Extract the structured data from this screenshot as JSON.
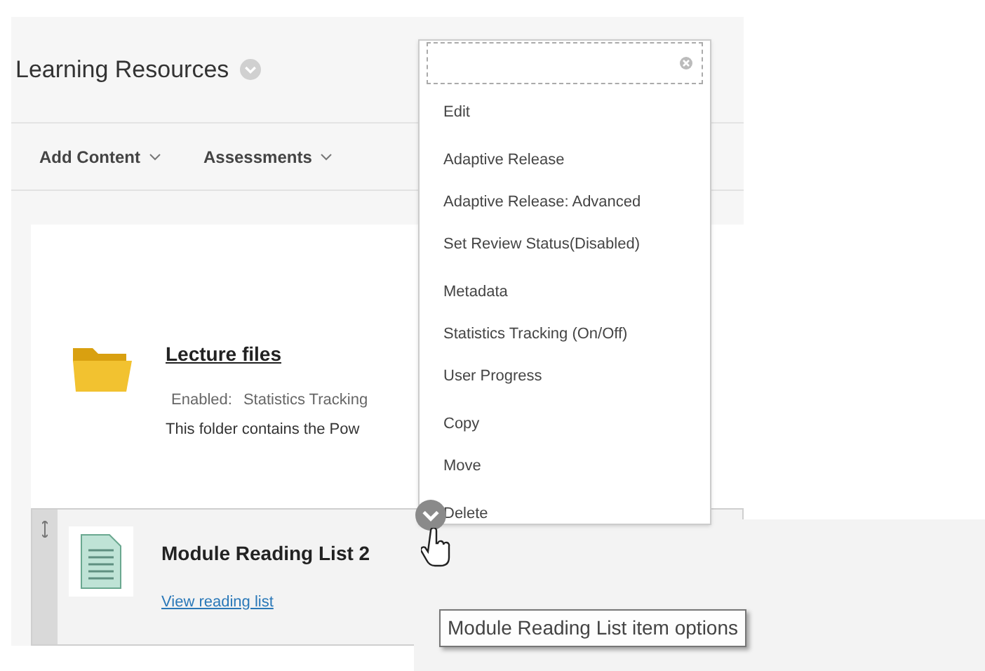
{
  "page": {
    "title": "Learning Resources"
  },
  "toolbar": [
    {
      "label": "Add Content"
    },
    {
      "label": "Assessments"
    }
  ],
  "items": [
    {
      "kind": "folder",
      "title": "Lecture files",
      "meta_label": "Enabled:",
      "meta_value": "Statistics Tracking",
      "description": "This folder contains the Pow"
    },
    {
      "kind": "document",
      "title": "Module Reading List 2",
      "link": "View reading list"
    }
  ],
  "menu": {
    "groups": [
      {
        "items": [
          "Edit"
        ]
      },
      {
        "items": [
          "Adaptive Release",
          "Adaptive Release: Advanced",
          "Set Review Status(Disabled)"
        ]
      },
      {
        "items": [
          "Metadata",
          "Statistics Tracking (On/Off)",
          "User Progress"
        ]
      },
      {
        "items": [
          "Copy",
          "Move"
        ]
      },
      {
        "items": [
          "Delete"
        ]
      }
    ]
  },
  "tooltip": "Module Reading List item options"
}
